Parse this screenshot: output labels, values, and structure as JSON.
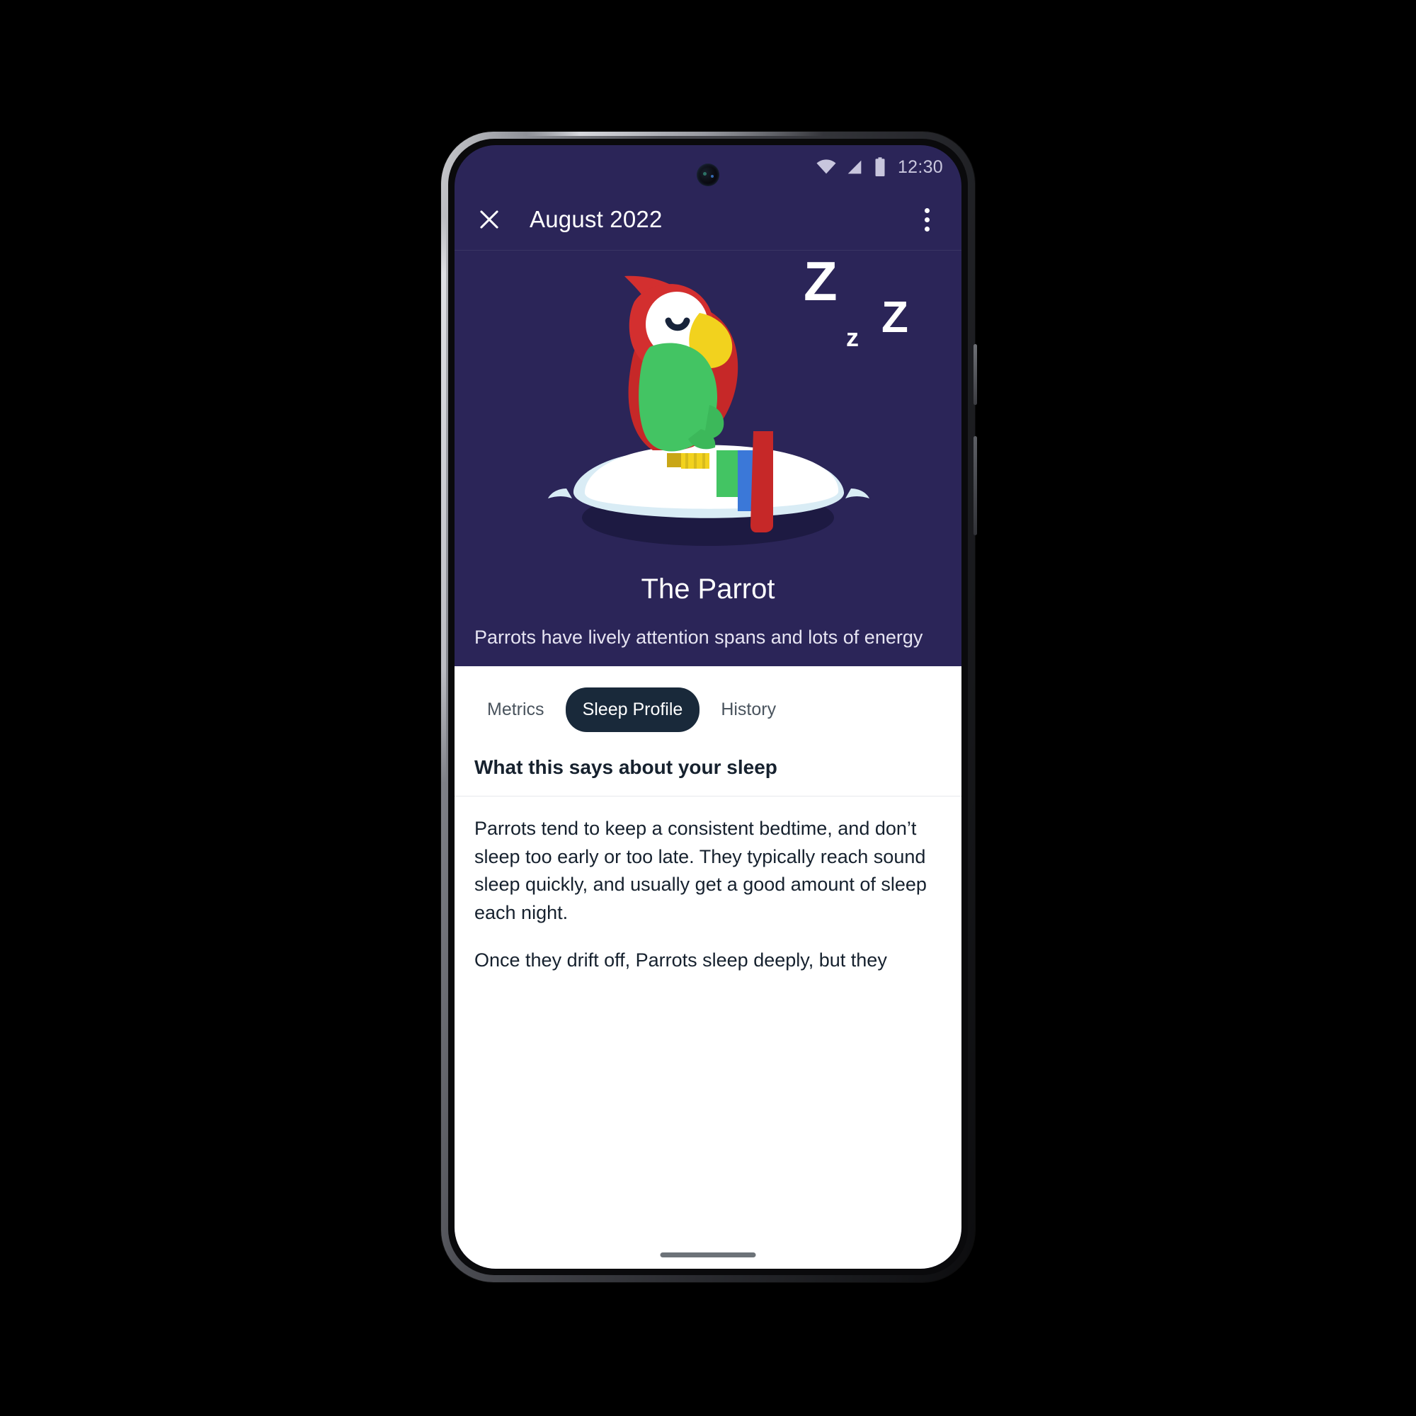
{
  "status_bar": {
    "time": "12:30",
    "icons": [
      "wifi-icon",
      "cellular-signal-icon",
      "battery-icon"
    ]
  },
  "app_bar": {
    "close_icon": "close-icon",
    "title": "August 2022",
    "overflow_icon": "more-vert-icon"
  },
  "hero": {
    "illustration": "sleeping-parrot-on-pillow-illustration",
    "sleep_zs": [
      "Z",
      "z",
      "Z"
    ],
    "title": "The Parrot",
    "description": "Parrots have lively attention spans and lots of energy",
    "background_color": "#2b2558"
  },
  "tabs": [
    {
      "label": "Metrics",
      "active": false
    },
    {
      "label": "Sleep Profile",
      "active": true
    },
    {
      "label": "History",
      "active": false
    }
  ],
  "section": {
    "heading": "What this says about your sleep",
    "paragraphs": [
      "Parrots tend to keep a consistent bedtime, and don’t sleep too early or too late. They typically reach sound sleep quickly, and usually get a good amount of sleep each night.",
      "Once they drift off, Parrots sleep deeply, but they"
    ]
  },
  "colors": {
    "hero_background": "#2b2558",
    "sheet_background": "#ffffff",
    "active_tab_background": "#19293a",
    "text_dark": "#16212e",
    "parrot_red": "#d32f2f",
    "parrot_green": "#43c463",
    "parrot_yellow": "#f2d21e",
    "parrot_blue": "#3b78d8",
    "pillow_white": "#ffffff",
    "shadow_purple": "#1d1a42"
  }
}
